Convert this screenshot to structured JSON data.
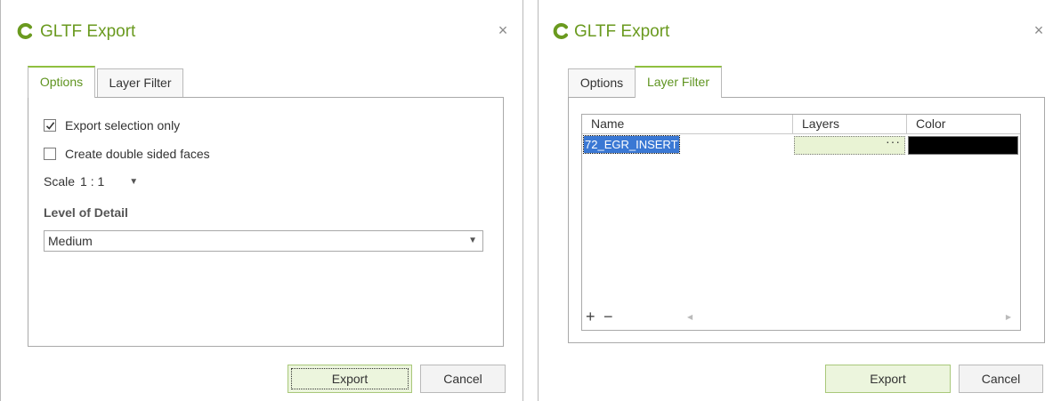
{
  "left": {
    "title": "GLTF Export",
    "tabs": [
      "Options",
      "Layer Filter"
    ],
    "options": {
      "export_selection_only": "Export selection only",
      "create_double_sided": "Create double sided faces",
      "scale_label": "Scale",
      "scale_value": "1 : 1",
      "lod_label": "Level of Detail",
      "lod_value": "Medium"
    },
    "buttons": {
      "export": "Export",
      "cancel": "Cancel"
    }
  },
  "right": {
    "title": "GLTF Export",
    "tabs": [
      "Options",
      "Layer Filter"
    ],
    "grid": {
      "columns": [
        "Name",
        "Layers",
        "Color"
      ],
      "rows": [
        {
          "name": "72_EGR_INSERT",
          "layers": "···",
          "color": "#000000"
        }
      ],
      "add": "+",
      "remove": "−"
    },
    "buttons": {
      "export": "Export",
      "cancel": "Cancel"
    }
  },
  "icons": {
    "logo": "c-logo-icon",
    "close": "close-icon",
    "check": "checkmark-icon",
    "dropdown": "chevron-down-icon",
    "ellipsis": "ellipsis-icon"
  },
  "colors": {
    "accent": "#6a9a1f",
    "tab_active_border": "#8fbf3f",
    "primary_button_bg": "#ecf5dd",
    "row_selection": "#3a78d4"
  }
}
